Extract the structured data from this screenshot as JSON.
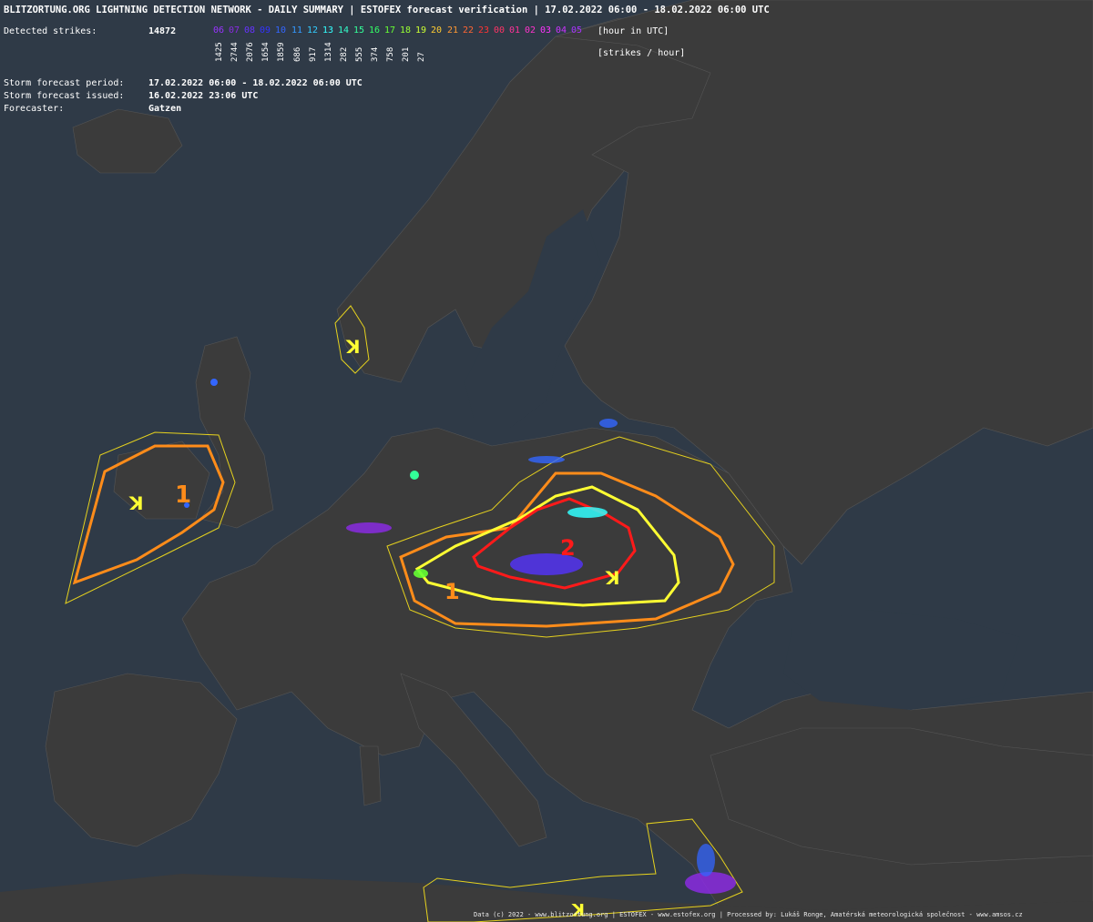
{
  "header": {
    "title": "BLITZORTUNG.ORG LIGHTNING DETECTION NETWORK - DAILY SUMMARY | ESTOFEX forecast verification | 17.02.2022 06:00 - 18.02.2022 06:00 UTC"
  },
  "strikes": {
    "label": "Detected strikes:",
    "total": "14872",
    "hour_unit_label": "[hour in UTC]",
    "count_unit_label": "[strikes / hour]",
    "hours": [
      {
        "hour": "06",
        "color": "#9933ff",
        "count": "1425"
      },
      {
        "hour": "07",
        "color": "#8a2be2",
        "count": "2744"
      },
      {
        "hour": "08",
        "color": "#6633ff",
        "count": "2076"
      },
      {
        "hour": "09",
        "color": "#3333ff",
        "count": "1654"
      },
      {
        "hour": "10",
        "color": "#3366ff",
        "count": "1859"
      },
      {
        "hour": "11",
        "color": "#3399ff",
        "count": "686"
      },
      {
        "hour": "12",
        "color": "#33ccff",
        "count": "917"
      },
      {
        "hour": "13",
        "color": "#33ffff",
        "count": "1314"
      },
      {
        "hour": "14",
        "color": "#33ffcc",
        "count": "282"
      },
      {
        "hour": "15",
        "color": "#33ff99",
        "count": "555"
      },
      {
        "hour": "16",
        "color": "#33ff66",
        "count": "374"
      },
      {
        "hour": "17",
        "color": "#66ff33",
        "count": "758"
      },
      {
        "hour": "18",
        "color": "#99ff33",
        "count": "201"
      },
      {
        "hour": "19",
        "color": "#ccff33",
        "count": "27"
      },
      {
        "hour": "20",
        "color": "#ffcc33",
        "count": ""
      },
      {
        "hour": "21",
        "color": "#ff9933",
        "count": ""
      },
      {
        "hour": "22",
        "color": "#ff6633",
        "count": ""
      },
      {
        "hour": "23",
        "color": "#ff3333",
        "count": ""
      },
      {
        "hour": "00",
        "color": "#ff3366",
        "count": ""
      },
      {
        "hour": "01",
        "color": "#ff3399",
        "count": ""
      },
      {
        "hour": "02",
        "color": "#ff33cc",
        "count": ""
      },
      {
        "hour": "03",
        "color": "#ff33ff",
        "count": ""
      },
      {
        "hour": "04",
        "color": "#cc33ff",
        "count": ""
      },
      {
        "hour": "05",
        "color": "#aa33ff",
        "count": ""
      }
    ]
  },
  "forecast": {
    "period_label": "Storm forecast period:",
    "period_value": "17.02.2022 06:00 - 18.02.2022 06:00 UTC",
    "issued_label": "Storm forecast issued:",
    "issued_value": "16.02.2022 23:06 UTC",
    "forecaster_label": "Forecaster:",
    "forecaster_value": "Gatzen"
  },
  "map": {
    "colors": {
      "sea": "#2f3a47",
      "land": "#3b3b3b",
      "level1": "#ff8c1a",
      "level2": "#ff1a1a",
      "lightning_area": "#ffff33",
      "thin_outline": "#e6d21e"
    },
    "labels": {
      "level1_ireland": "1",
      "level1_alps": "1",
      "level2_hungary": "2",
      "lightning_ireland": "ꓘ",
      "lightning_norway": "ꓘ",
      "lightning_hungary": "ꓘ",
      "lightning_mediterranean": "ꓘ"
    }
  },
  "footer": {
    "credits": "Data (c) 2022 - www.blitzortung.org | ESTOFEX - www.estofex.org | Processed by: Lukáš Ronge, Amatérská meteorologická společnost - www.amsos.cz"
  }
}
